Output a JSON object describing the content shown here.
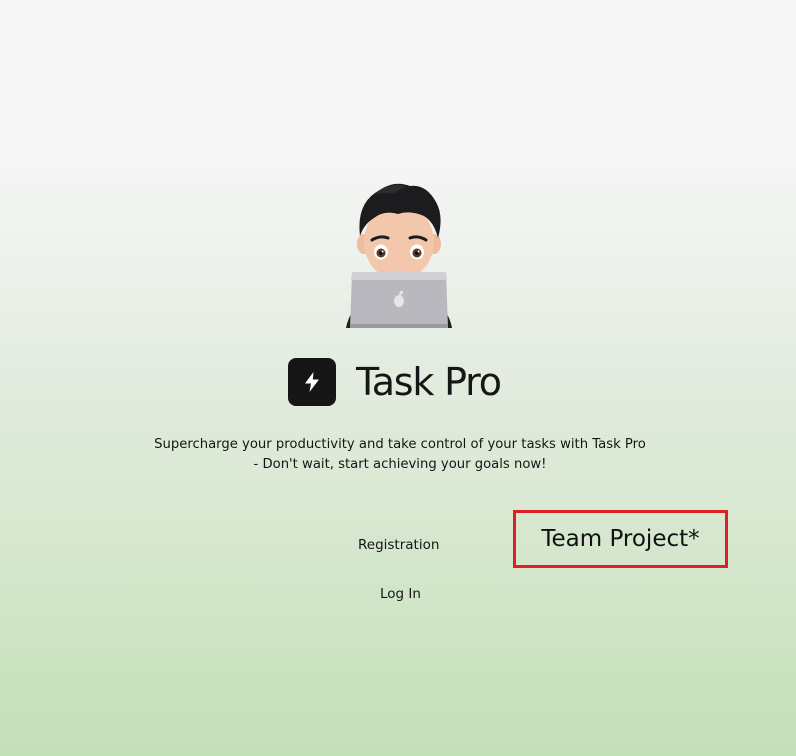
{
  "app": {
    "title": "Task Pro",
    "tagline": "Supercharge your productivity and take control of your tasks with Task Pro - Don't wait, start achieving your goals now!"
  },
  "nav": {
    "registration": "Registration",
    "login": "Log In"
  },
  "annotation": {
    "label": "Team Project*",
    "border_color": "#e01e25"
  },
  "icons": {
    "logo": "lightning-bolt-icon",
    "avatar": "memoji-laptop-avatar"
  },
  "colors": {
    "text": "#161616",
    "logo_bg": "#161616",
    "bg_top": "#f6f6f6",
    "bg_bottom": "#c4e0b8"
  }
}
